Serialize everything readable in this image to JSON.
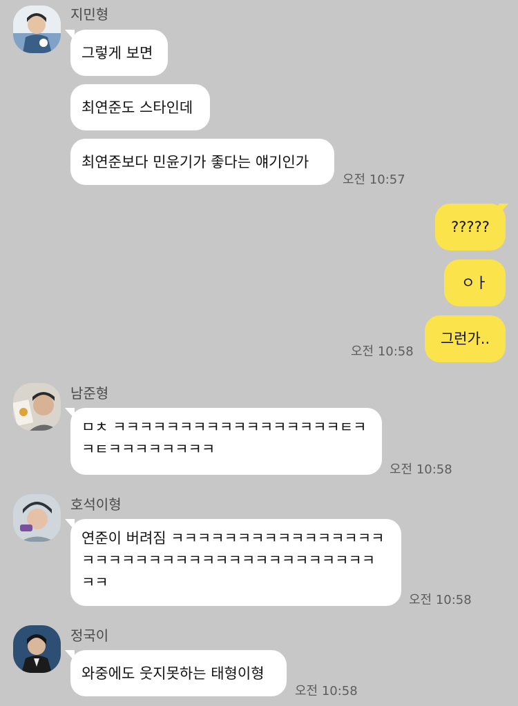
{
  "messages_group_1": {
    "sender": "지민형",
    "bubbles": [
      "그렇게 보면",
      "최연준도 스타인데",
      "최연준보다 민윤기가 좋다는 얘기인가"
    ],
    "time": "오전 10:57"
  },
  "messages_group_mine": {
    "bubbles": [
      "?????",
      "ㅇㅏ",
      "그런가.."
    ],
    "time": "오전 10:58"
  },
  "messages_group_2": {
    "sender": "남준형",
    "lines": [
      "ㅁㅊ ㅋㅋㅋㅋㅋㅋㅋㅋㅋㅋㅋㅋㅋㅋㅋㅋㅋㅌㅋ",
      "ㅋㅌㅋㅋㅋㅋㅋㅋㅋㅋ"
    ],
    "time": "오전 10:58"
  },
  "messages_group_3": {
    "sender": "호석이형",
    "lines": [
      "연준이 버려짐 ㅋㅋㅋㅋㅋㅋㅋㅋㅋㅋㅋㅋㅋㅋㅋㅋ",
      "ㅋㅋㅋㅋㅋㅋㅋㅋㅋㅋㅋㅋㅋㅋㅋㅋㅋㅋㅋㅋㅋㅋ",
      "ㅋㅋ"
    ],
    "time": "오전 10:58"
  },
  "messages_group_4": {
    "sender": "정국이",
    "bubbles": [
      "와중에도 웃지못하는 태형이형"
    ],
    "time": "오전 10:58"
  },
  "colors": {
    "background": "#c7c7c7",
    "incoming_bubble": "#ffffff",
    "outgoing_bubble": "#fae34b"
  }
}
